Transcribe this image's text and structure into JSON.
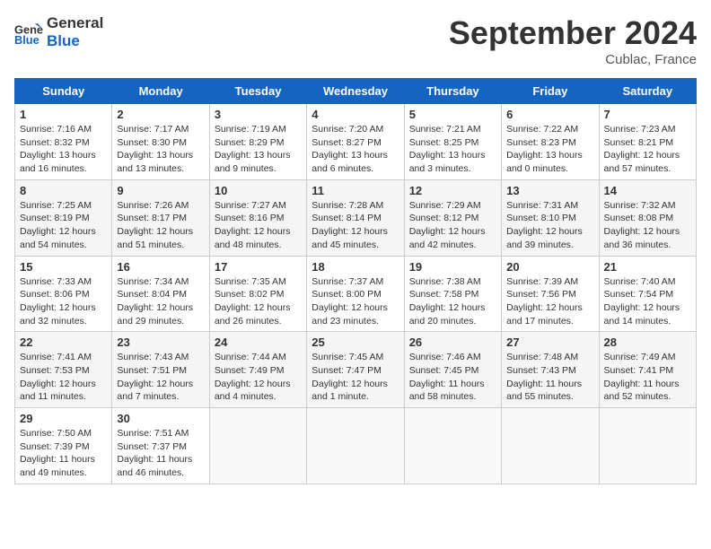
{
  "header": {
    "logo_line1": "General",
    "logo_line2": "Blue",
    "month_title": "September 2024",
    "location": "Cublac, France"
  },
  "weekdays": [
    "Sunday",
    "Monday",
    "Tuesday",
    "Wednesday",
    "Thursday",
    "Friday",
    "Saturday"
  ],
  "weeks": [
    [
      {
        "day": "1",
        "sunrise": "Sunrise: 7:16 AM",
        "sunset": "Sunset: 8:32 PM",
        "daylight": "Daylight: 13 hours and 16 minutes."
      },
      {
        "day": "2",
        "sunrise": "Sunrise: 7:17 AM",
        "sunset": "Sunset: 8:30 PM",
        "daylight": "Daylight: 13 hours and 13 minutes."
      },
      {
        "day": "3",
        "sunrise": "Sunrise: 7:19 AM",
        "sunset": "Sunset: 8:29 PM",
        "daylight": "Daylight: 13 hours and 9 minutes."
      },
      {
        "day": "4",
        "sunrise": "Sunrise: 7:20 AM",
        "sunset": "Sunset: 8:27 PM",
        "daylight": "Daylight: 13 hours and 6 minutes."
      },
      {
        "day": "5",
        "sunrise": "Sunrise: 7:21 AM",
        "sunset": "Sunset: 8:25 PM",
        "daylight": "Daylight: 13 hours and 3 minutes."
      },
      {
        "day": "6",
        "sunrise": "Sunrise: 7:22 AM",
        "sunset": "Sunset: 8:23 PM",
        "daylight": "Daylight: 13 hours and 0 minutes."
      },
      {
        "day": "7",
        "sunrise": "Sunrise: 7:23 AM",
        "sunset": "Sunset: 8:21 PM",
        "daylight": "Daylight: 12 hours and 57 minutes."
      }
    ],
    [
      {
        "day": "8",
        "sunrise": "Sunrise: 7:25 AM",
        "sunset": "Sunset: 8:19 PM",
        "daylight": "Daylight: 12 hours and 54 minutes."
      },
      {
        "day": "9",
        "sunrise": "Sunrise: 7:26 AM",
        "sunset": "Sunset: 8:17 PM",
        "daylight": "Daylight: 12 hours and 51 minutes."
      },
      {
        "day": "10",
        "sunrise": "Sunrise: 7:27 AM",
        "sunset": "Sunset: 8:16 PM",
        "daylight": "Daylight: 12 hours and 48 minutes."
      },
      {
        "day": "11",
        "sunrise": "Sunrise: 7:28 AM",
        "sunset": "Sunset: 8:14 PM",
        "daylight": "Daylight: 12 hours and 45 minutes."
      },
      {
        "day": "12",
        "sunrise": "Sunrise: 7:29 AM",
        "sunset": "Sunset: 8:12 PM",
        "daylight": "Daylight: 12 hours and 42 minutes."
      },
      {
        "day": "13",
        "sunrise": "Sunrise: 7:31 AM",
        "sunset": "Sunset: 8:10 PM",
        "daylight": "Daylight: 12 hours and 39 minutes."
      },
      {
        "day": "14",
        "sunrise": "Sunrise: 7:32 AM",
        "sunset": "Sunset: 8:08 PM",
        "daylight": "Daylight: 12 hours and 36 minutes."
      }
    ],
    [
      {
        "day": "15",
        "sunrise": "Sunrise: 7:33 AM",
        "sunset": "Sunset: 8:06 PM",
        "daylight": "Daylight: 12 hours and 32 minutes."
      },
      {
        "day": "16",
        "sunrise": "Sunrise: 7:34 AM",
        "sunset": "Sunset: 8:04 PM",
        "daylight": "Daylight: 12 hours and 29 minutes."
      },
      {
        "day": "17",
        "sunrise": "Sunrise: 7:35 AM",
        "sunset": "Sunset: 8:02 PM",
        "daylight": "Daylight: 12 hours and 26 minutes."
      },
      {
        "day": "18",
        "sunrise": "Sunrise: 7:37 AM",
        "sunset": "Sunset: 8:00 PM",
        "daylight": "Daylight: 12 hours and 23 minutes."
      },
      {
        "day": "19",
        "sunrise": "Sunrise: 7:38 AM",
        "sunset": "Sunset: 7:58 PM",
        "daylight": "Daylight: 12 hours and 20 minutes."
      },
      {
        "day": "20",
        "sunrise": "Sunrise: 7:39 AM",
        "sunset": "Sunset: 7:56 PM",
        "daylight": "Daylight: 12 hours and 17 minutes."
      },
      {
        "day": "21",
        "sunrise": "Sunrise: 7:40 AM",
        "sunset": "Sunset: 7:54 PM",
        "daylight": "Daylight: 12 hours and 14 minutes."
      }
    ],
    [
      {
        "day": "22",
        "sunrise": "Sunrise: 7:41 AM",
        "sunset": "Sunset: 7:53 PM",
        "daylight": "Daylight: 12 hours and 11 minutes."
      },
      {
        "day": "23",
        "sunrise": "Sunrise: 7:43 AM",
        "sunset": "Sunset: 7:51 PM",
        "daylight": "Daylight: 12 hours and 7 minutes."
      },
      {
        "day": "24",
        "sunrise": "Sunrise: 7:44 AM",
        "sunset": "Sunset: 7:49 PM",
        "daylight": "Daylight: 12 hours and 4 minutes."
      },
      {
        "day": "25",
        "sunrise": "Sunrise: 7:45 AM",
        "sunset": "Sunset: 7:47 PM",
        "daylight": "Daylight: 12 hours and 1 minute."
      },
      {
        "day": "26",
        "sunrise": "Sunrise: 7:46 AM",
        "sunset": "Sunset: 7:45 PM",
        "daylight": "Daylight: 11 hours and 58 minutes."
      },
      {
        "day": "27",
        "sunrise": "Sunrise: 7:48 AM",
        "sunset": "Sunset: 7:43 PM",
        "daylight": "Daylight: 11 hours and 55 minutes."
      },
      {
        "day": "28",
        "sunrise": "Sunrise: 7:49 AM",
        "sunset": "Sunset: 7:41 PM",
        "daylight": "Daylight: 11 hours and 52 minutes."
      }
    ],
    [
      {
        "day": "29",
        "sunrise": "Sunrise: 7:50 AM",
        "sunset": "Sunset: 7:39 PM",
        "daylight": "Daylight: 11 hours and 49 minutes."
      },
      {
        "day": "30",
        "sunrise": "Sunrise: 7:51 AM",
        "sunset": "Sunset: 7:37 PM",
        "daylight": "Daylight: 11 hours and 46 minutes."
      },
      null,
      null,
      null,
      null,
      null
    ]
  ]
}
